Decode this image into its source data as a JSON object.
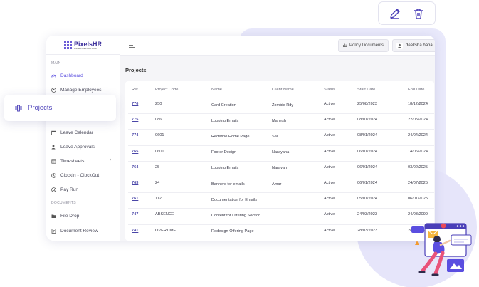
{
  "actions": {
    "edit_icon": "pencil-icon",
    "delete_icon": "trash-icon"
  },
  "brand": {
    "name": "PixelsHR",
    "sub": "WWW.PIXELSHR.COM"
  },
  "sidebar": {
    "sections": [
      {
        "label": "MAIN"
      },
      {
        "label": "DOCUMENTS"
      }
    ],
    "items": [
      {
        "label": "Dashboard",
        "icon": "gauge-icon"
      },
      {
        "label": "Manage Employees",
        "icon": "users-icon"
      },
      {
        "label": "Leave Calendar",
        "icon": "calendar-icon"
      },
      {
        "label": "Leave Approvals",
        "icon": "user-check-icon"
      },
      {
        "label": "Timesheets",
        "icon": "sheet-icon"
      },
      {
        "label": "ClockIn - ClockOut",
        "icon": "clock-icon"
      },
      {
        "label": "Pay Run",
        "icon": "coin-icon"
      },
      {
        "label": "File Drop",
        "icon": "folder-icon"
      },
      {
        "label": "Document Review",
        "icon": "document-icon"
      }
    ],
    "floating": {
      "label": "Projects",
      "icon": "projects-icon"
    }
  },
  "topbar": {
    "policy_label": "Policy Documents",
    "user_label": "deeksha.bapa"
  },
  "page": {
    "title": "Projects"
  },
  "table": {
    "headers": [
      "Ref",
      "Project Code",
      "Name",
      "Client Name",
      "Status",
      "Start Date",
      "End Date"
    ],
    "rows": [
      [
        "776",
        "250",
        "Card Creation",
        "Zombie Rdy",
        "Active",
        "25/08/2023",
        "18/12/2024"
      ],
      [
        "775",
        "086",
        "Looping Emails",
        "Mahesh",
        "Active",
        "08/01/2024",
        "22/05/2024"
      ],
      [
        "774",
        "0601",
        "Redefine Home Page",
        "Sai",
        "Active",
        "08/01/2024",
        "24/04/2024"
      ],
      [
        "765",
        "0601",
        "Footer Design",
        "Narayana",
        "Active",
        "06/01/2024",
        "14/06/2024"
      ],
      [
        "764",
        "25",
        "Looping Emails",
        "Narayan",
        "Active",
        "06/01/2024",
        "03/02/2025"
      ],
      [
        "763",
        "24",
        "Banners for emails",
        "Amar",
        "Active",
        "06/01/2024",
        "24/07/2025"
      ],
      [
        "761",
        "112",
        "Documentation for Emails",
        "",
        "Active",
        "05/01/2024",
        "06/01/2025"
      ],
      [
        "747",
        "ABSENCE",
        "Content for Offering Section",
        "",
        "Active",
        "24/03/2023",
        "24/03/2099"
      ],
      [
        "741",
        "OVERTIME",
        "Redesign Offering Page",
        "",
        "Active",
        "28/03/2023",
        "28/03/2099"
      ]
    ]
  },
  "colors": {
    "accent": "#5a4ee0",
    "brand": "#3c2f9c",
    "background_shape": "#e9e9fb"
  }
}
